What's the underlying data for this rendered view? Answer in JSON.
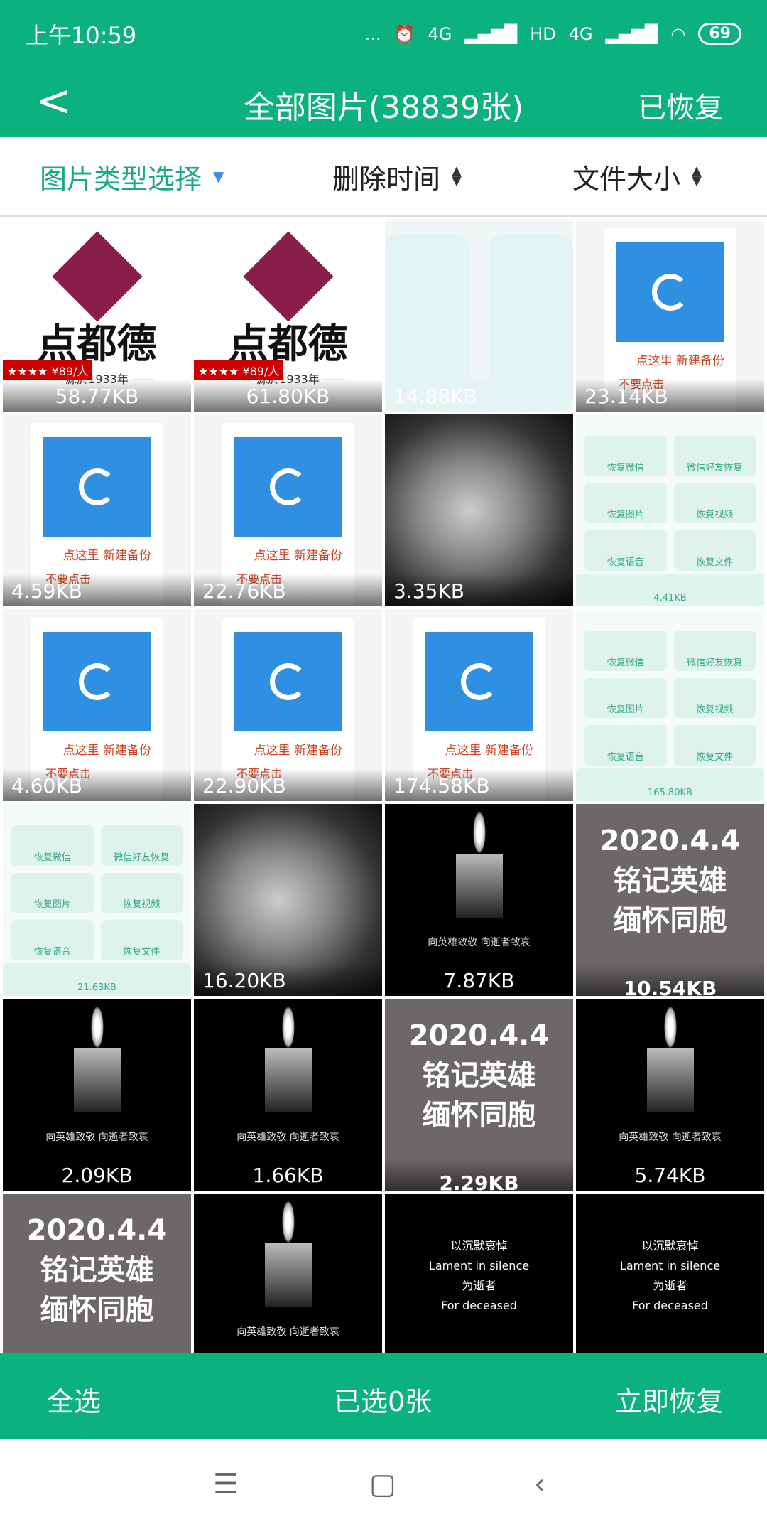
{
  "status": {
    "time": "上午10:59",
    "dots": "...",
    "battery": "69",
    "net1": "4G",
    "net2": "4G",
    "hd": "HD"
  },
  "header": {
    "title": "全部图片(38839张)",
    "restored": "已恢复"
  },
  "filters": {
    "type": "图片类型选择",
    "delete_time": "删除时间",
    "file_size": "文件大小"
  },
  "texts": {
    "logo_name": "点都德",
    "logo_sub": "—— 源於1933年 ——",
    "logo_rating": "★★★★ ¥89/人",
    "backup": "点这里 新建备份",
    "dont": "不要点击",
    "menu": [
      "恢复微信",
      "微信好友恢复",
      "恢复图片",
      "恢复视频",
      "恢复语音",
      "恢复文件"
    ],
    "candle": "向英雄致敬 向逝者致哀",
    "memo": [
      "2020.4.4",
      "铭记英雄",
      "缅怀同胞"
    ],
    "lament": [
      "以沉默哀悼",
      "Lament in silence",
      "为逝者",
      "For deceased"
    ]
  },
  "tiles": [
    {
      "kind": "logo",
      "size": "58.77KB"
    },
    {
      "kind": "logo",
      "size": "61.80KB"
    },
    {
      "kind": "blank",
      "size": "14.88KB"
    },
    {
      "kind": "app",
      "size": "23.14KB"
    },
    {
      "kind": "app",
      "size": "4.59KB"
    },
    {
      "kind": "app",
      "size": "22.76KB"
    },
    {
      "kind": "photo",
      "size": "3.35KB"
    },
    {
      "kind": "menu",
      "size": "4.41KB"
    },
    {
      "kind": "app",
      "size": "4.60KB"
    },
    {
      "kind": "app",
      "size": "22.90KB"
    },
    {
      "kind": "app",
      "size": "174.58KB"
    },
    {
      "kind": "menu",
      "size": "165.80KB"
    },
    {
      "kind": "menu",
      "size": "21.63KB"
    },
    {
      "kind": "photo",
      "size": "16.20KB"
    },
    {
      "kind": "candle",
      "size": "7.87KB"
    },
    {
      "kind": "memo",
      "size": "10.54KB"
    },
    {
      "kind": "candle",
      "size": "2.09KB"
    },
    {
      "kind": "candle",
      "size": "1.66KB"
    },
    {
      "kind": "memo",
      "size": "2.29KB"
    },
    {
      "kind": "candle",
      "size": "5.74KB"
    },
    {
      "kind": "memo",
      "size": ""
    },
    {
      "kind": "candle",
      "size": ""
    },
    {
      "kind": "lament",
      "size": ""
    },
    {
      "kind": "lament",
      "size": ""
    }
  ],
  "bottom": {
    "select_all": "全选",
    "selected": "已选0张",
    "restore_now": "立即恢复"
  },
  "colors": {
    "brand": "#0cb27e",
    "active_filter": "#18a883"
  }
}
